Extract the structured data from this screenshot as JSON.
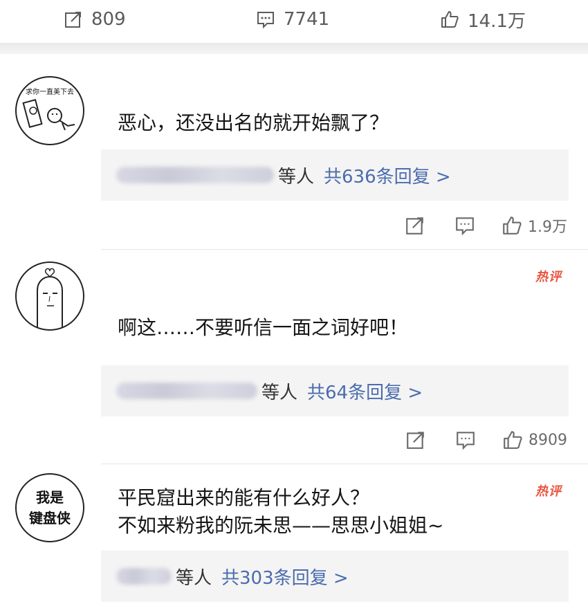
{
  "topbar": {
    "share_count": "809",
    "comment_count": "7741",
    "like_count": "14.1万"
  },
  "comments": [
    {
      "avatar_caption": "求你一直美下去",
      "text": "恶心，还没出名的就开始飘了？",
      "reply_suffix": "等人",
      "reply_count": "共636条回复 >",
      "like_count": "1.9万",
      "hot": false
    },
    {
      "text": "啊这……不要听信一面之词好吧！",
      "reply_suffix": "等人",
      "reply_count": "共64条回复 >",
      "like_count": "8909",
      "hot": true,
      "hot_label": "热评"
    },
    {
      "avatar_caption": "我是\n键盘侠",
      "text": "平民窟出来的能有什么好人？\n不如来粉我的阮未思——思思小姐姐~",
      "reply_suffix": "等人",
      "reply_count": "共303条回复 >",
      "hot": true,
      "hot_label": "热评"
    }
  ],
  "icons": {
    "share": "share-icon",
    "comment": "comment-icon",
    "like": "thumbs-up-icon"
  },
  "colors": {
    "link_blue": "#4b6cae",
    "hot_red": "#e9543f",
    "reply_bg": "#f4f4f4"
  }
}
